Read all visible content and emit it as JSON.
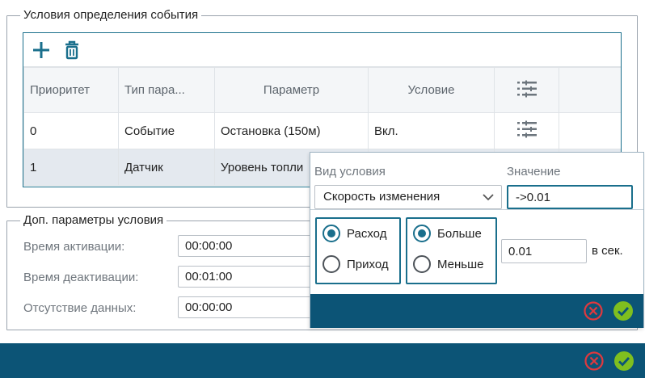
{
  "conditions_group": {
    "legend": "Условия определения события",
    "toolbar": {
      "add_icon": "plus-icon",
      "delete_icon": "trash-icon"
    },
    "columns": [
      "Приоритет",
      "Тип пара...",
      "Параметр",
      "Условие"
    ],
    "rows": [
      {
        "priority": "0",
        "type": "Событие",
        "param": "Остановка (150м)",
        "condition": "Вкл."
      },
      {
        "priority": "1",
        "type": "Датчик",
        "param": "Уровень топли",
        "condition": ""
      }
    ]
  },
  "extra_group": {
    "legend": "Доп. параметры условия",
    "fields": [
      {
        "label": "Время активации:",
        "value": "00:00:00"
      },
      {
        "label": "Время деактивации:",
        "value": "00:01:00"
      },
      {
        "label": "Отсутствие данных:",
        "value": "00:00:00"
      }
    ]
  },
  "popup": {
    "type_label": "Вид условия",
    "value_label": "Значение",
    "type_selected": "Скорость изменения",
    "value": "->0.01",
    "group1": [
      "Расход",
      "Приход"
    ],
    "group2": [
      "Больше",
      "Меньше"
    ],
    "group1_selected": 0,
    "group2_selected": 0,
    "rate_value": "0.01",
    "rate_unit": "в сек."
  },
  "colors": {
    "accent": "#1a6f8c",
    "footer": "#0c5476",
    "cancel": "#e0393e",
    "confirm": "#7fbf1f"
  }
}
